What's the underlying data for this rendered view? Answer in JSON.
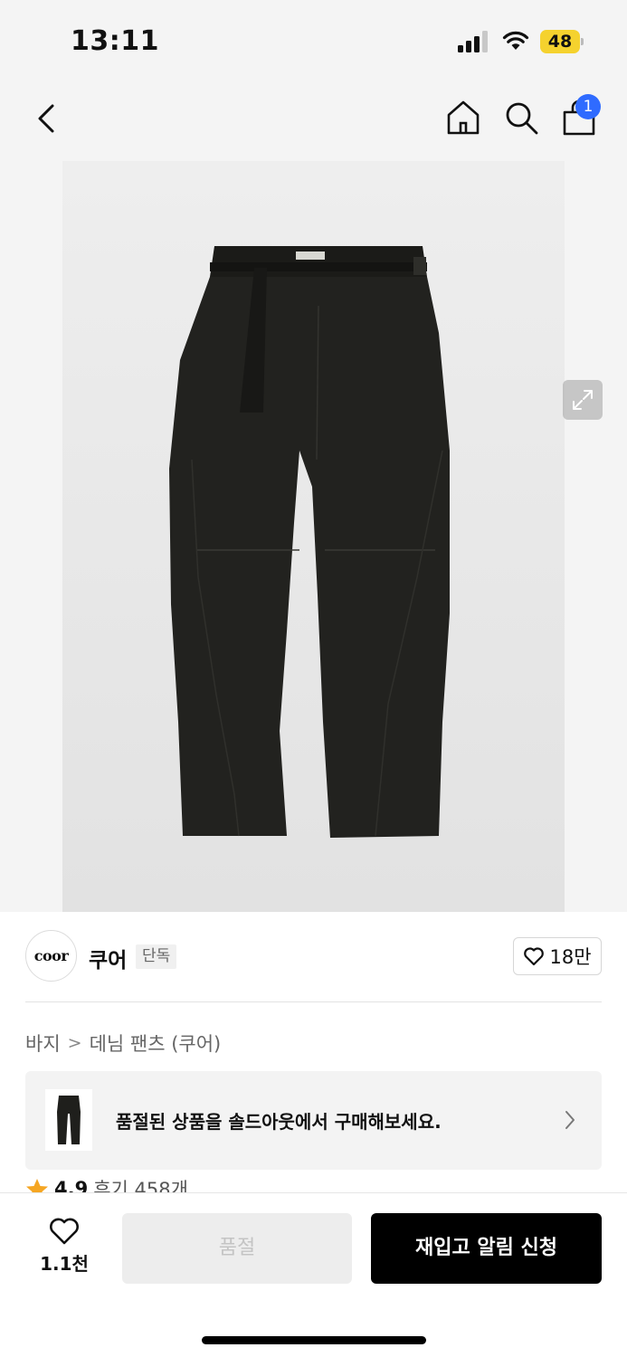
{
  "status_bar": {
    "time": "13:11",
    "battery": "48",
    "icons": [
      "signal-icon",
      "wifi-icon",
      "battery-icon"
    ]
  },
  "nav": {
    "icons": [
      "back-chevron-icon",
      "home-icon",
      "search-icon",
      "bag-icon"
    ],
    "cart_badge": "1"
  },
  "product_image": {
    "icon": "expand-icon"
  },
  "brand": {
    "logo_text": "coor",
    "name": "쿠어",
    "tag": "단독",
    "likes": "18만"
  },
  "breadcrumb": {
    "items": [
      "바지",
      "데님 팬츠 (쿠어)"
    ],
    "separator": ">"
  },
  "soldout_banner": {
    "text": "품절된 상품을 솔드아웃에서 구매해보세요."
  },
  "rating": {
    "value": "4.9",
    "reviews": "후기 458개"
  },
  "bottom_bar": {
    "wish_count": "1.1천",
    "soldout_label": "품절",
    "restock_label": "재입고 알림 신청"
  },
  "colors": {
    "accent_badge": "#2f6bff",
    "battery": "#f5d22e",
    "star": "#f5a623",
    "primary_button": "#000000"
  }
}
